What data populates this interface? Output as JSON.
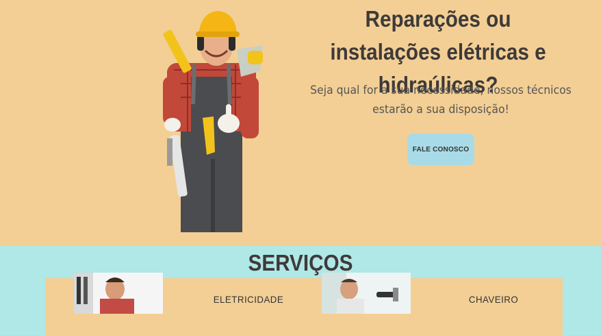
{
  "hero": {
    "title": "Reparações ou instalações elétricas e hidraúlicas?",
    "subtitle": "Seja qual for a sua necessidade, nossos técnicos estarão a sua disposição!",
    "cta_label": "FALE CONOSCO"
  },
  "services": {
    "title": "SERVIÇOS",
    "items": [
      {
        "label": "ELETRICIDADE"
      },
      {
        "label": "CHAVEIRO"
      }
    ]
  },
  "colors": {
    "hero_bg": "#f3cf95",
    "services_bg": "#b0e7e7",
    "cta_bg": "#a8dbe7",
    "title_text": "#3e3a39"
  }
}
